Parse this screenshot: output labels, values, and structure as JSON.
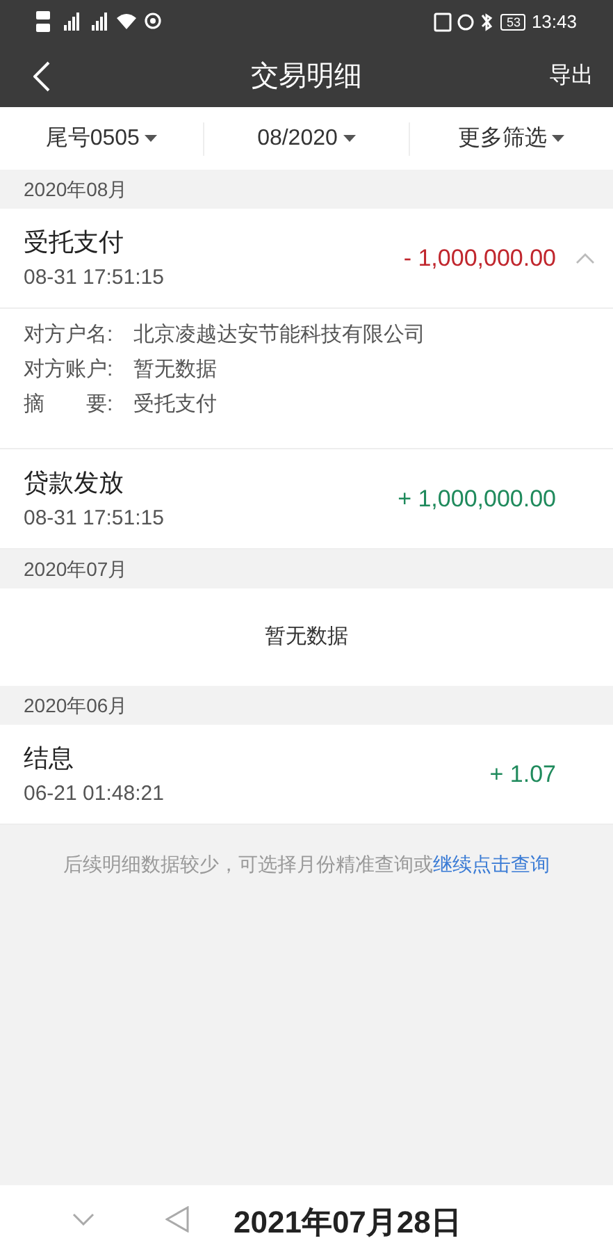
{
  "status_bar": {
    "battery": "53",
    "time": "13:43"
  },
  "header": {
    "title": "交易明细",
    "action": "导出"
  },
  "filters": [
    {
      "label": "尾号0505"
    },
    {
      "label": "08/2020"
    },
    {
      "label": "更多筛选"
    }
  ],
  "sections": [
    {
      "month": "2020年08月",
      "items": [
        {
          "kind": "transaction",
          "title": "受托支付",
          "time": "08-31 17:51:15",
          "amount": "- 1,000,000.00",
          "color": "#c0262d",
          "expanded": true,
          "details": [
            {
              "label": "对方户名:",
              "value": "北京凌越达安节能科技有限公司"
            },
            {
              "label": "对方账户:",
              "value": "暂无数据"
            },
            {
              "label": "摘　　要:",
              "value": "受托支付"
            }
          ]
        },
        {
          "kind": "transaction",
          "title": "贷款发放",
          "time": "08-31 17:51:15",
          "amount": "+ 1,000,000.00",
          "color": "#1f8a5c",
          "expanded": false
        }
      ]
    },
    {
      "month": "2020年07月",
      "items": [
        {
          "kind": "empty",
          "text": "暂无数据"
        }
      ]
    },
    {
      "month": "2020年06月",
      "items": [
        {
          "kind": "transaction",
          "title": "结息",
          "time": "06-21 01:48:21",
          "amount": "+ 1.07",
          "color": "#1f8a5c",
          "expanded": false
        }
      ]
    }
  ],
  "footer_note": {
    "text": "后续明细数据较少，可选择月份精准查询或",
    "link": "继续点击查询"
  },
  "date_stamp": "2021年07月28日"
}
